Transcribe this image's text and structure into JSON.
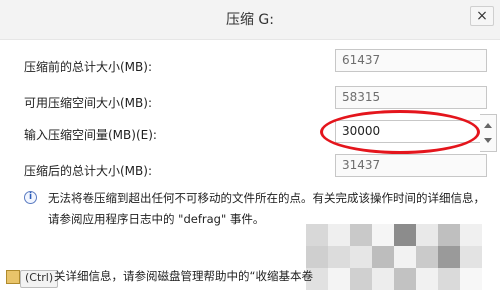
{
  "dialog": {
    "title": "压缩 G:",
    "close_symbol": "×"
  },
  "fields": {
    "total_before": {
      "label": "压缩前的总计大小(MB):",
      "value": "61437"
    },
    "available_shrink": {
      "label": "可用压缩空间大小(MB):",
      "value": "58315"
    },
    "shrink_amount": {
      "label": "输入压缩空间量(MB)(E):",
      "value": "30000"
    },
    "total_after": {
      "label": "压缩后的总计大小(MB):",
      "value": "31437"
    }
  },
  "info": {
    "text": "无法将卷压缩到超出任何不可移动的文件所在的点。有关完成该操作时间的详细信息，请参阅应用程序日志中的 \"defrag\" 事件。"
  },
  "footer": {
    "ctrl_tag": "(Ctrl)",
    "text": "关详细信息，请参阅磁盘管理帮助中的“收缩基本卷"
  },
  "colors": {
    "highlight_ring": "#e4151c",
    "accent": "#2a5bb8"
  },
  "icons": {
    "info": "info-icon",
    "close": "close-icon",
    "spinner": "spinner-arrows-icon",
    "clipboard": "clipboard-icon"
  }
}
